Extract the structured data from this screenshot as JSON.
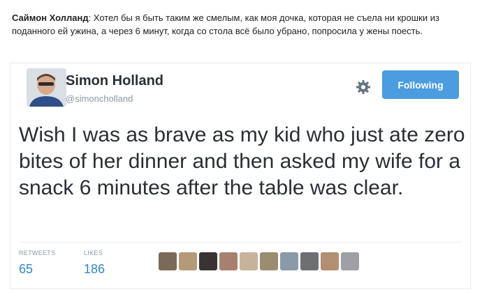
{
  "post": {
    "author": "Саймон Холланд",
    "separator": ": ",
    "text": "Хотел бы я быть таким же смелым, как моя дочка, которая не съела ни крошки из поданного ей ужина, а через 6 минут, когда со стола всё было убрано, попросила у жены поесть."
  },
  "tweet": {
    "name": "Simon Holland",
    "handle": "@simoncholland",
    "follow_label": "Following",
    "text": "Wish I was as brave as my kid who just ate zero bites of her dinner and then asked my wife for a snack 6 minutes after the table was clear.",
    "retweets_label": "RETWEETS",
    "retweets_count": "65",
    "likes_label": "LIKES",
    "likes_count": "186",
    "liker_colors": [
      "#7b6a58",
      "#b59a7a",
      "#3a3230",
      "#a88070",
      "#c7b39c",
      "#9c8c6f",
      "#8a9aa8",
      "#6e6f73",
      "#b28e72",
      "#9fa0a5"
    ]
  },
  "colors": {
    "follow_button": "#4b9de0",
    "count": "#2e89d0",
    "muted": "#8899a6",
    "text": "#292f33"
  },
  "icons": [
    "gear-icon",
    "avatar"
  ]
}
